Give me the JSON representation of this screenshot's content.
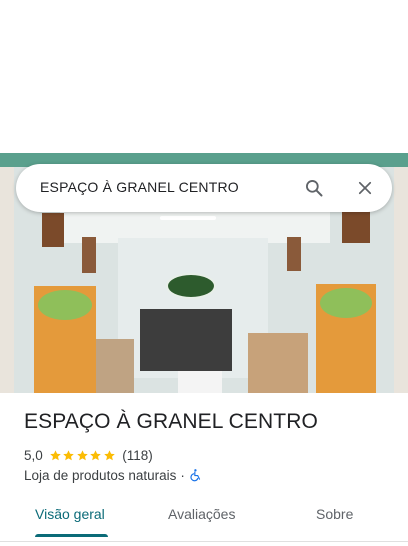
{
  "search": {
    "query": "ESPAÇO À GRANEL CENTRO"
  },
  "place": {
    "name": "ESPAÇO À GRANEL CENTRO",
    "rating": "5,0",
    "stars": 5,
    "review_count": "(118)",
    "category": "Loja de produtos naturais",
    "separator": "·"
  },
  "tabs": [
    {
      "label": "Visão geral",
      "active": true
    },
    {
      "label": "Avaliações",
      "active": false
    },
    {
      "label": "Sobre",
      "active": false
    }
  ],
  "colors": {
    "accent": "#0b6b78",
    "star": "#fbbc04",
    "accessible": "#1a73e8"
  },
  "icons": {
    "search": "search-icon",
    "close": "close-icon",
    "star": "star-icon",
    "accessible": "wheelchair-icon"
  }
}
